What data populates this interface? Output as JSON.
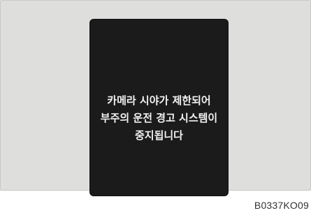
{
  "display": {
    "message_lines": [
      "카메라 시야가 제한되어",
      "부주의 운전 경고 시스템이",
      "중지됩니다"
    ]
  },
  "figure_code": "B0337KO09",
  "colors": {
    "background_panel": "#dededd",
    "screen": "#1b1b1b",
    "text": "#f2f2f2"
  }
}
